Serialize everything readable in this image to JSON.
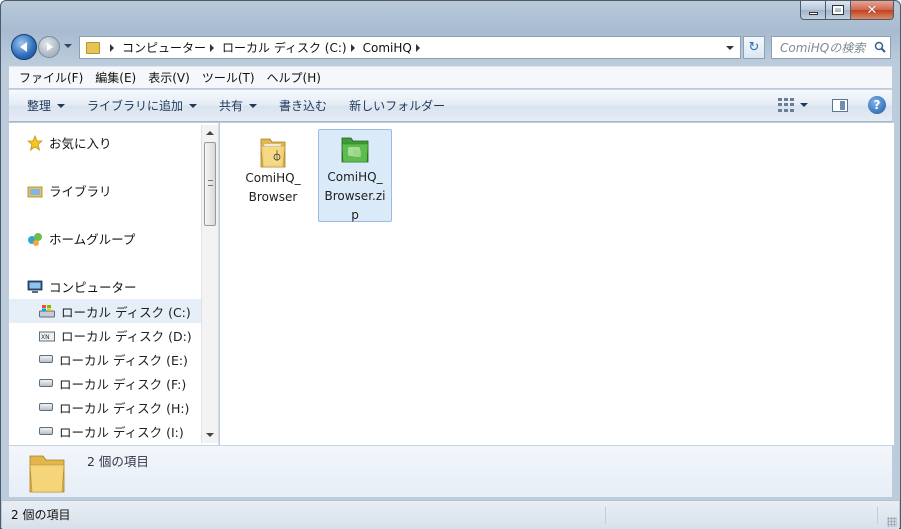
{
  "window": {
    "caption_min": "–",
    "caption_max": "□",
    "caption_close": "✕"
  },
  "navbar": {
    "breadcrumbs": [
      "コンピューター",
      "ローカル ディスク (C:)",
      "ComiHQ"
    ],
    "search_placeholder": "ComiHQの検索",
    "refresh_glyph": "↻"
  },
  "menubar": {
    "items": [
      "ファイル(F)",
      "編集(E)",
      "表示(V)",
      "ツール(T)",
      "ヘルプ(H)"
    ]
  },
  "commandbar": {
    "organize": "整理",
    "add_to_library": "ライブラリに追加",
    "share": "共有",
    "burn": "書き込む",
    "new_folder": "新しいフォルダー",
    "help_glyph": "?"
  },
  "navpane": {
    "favorites": "お気に入り",
    "libraries": "ライブラリ",
    "homegroup": "ホームグループ",
    "computer": "コンピューター",
    "drives": [
      {
        "label": "ローカル ディスク (C:)",
        "icon": "windows-drive-icon",
        "selected": true
      },
      {
        "label": "ローカル ディスク (D:)",
        "icon": "drive-icon",
        "selected": false
      },
      {
        "label": "ローカル ディスク (E:)",
        "icon": "drive-icon",
        "selected": false
      },
      {
        "label": "ローカル ディスク (F:)",
        "icon": "drive-icon",
        "selected": false
      },
      {
        "label": "ローカル ディスク (H:)",
        "icon": "drive-icon",
        "selected": false
      },
      {
        "label": "ローカル ディスク (I:)",
        "icon": "drive-icon",
        "selected": false
      }
    ]
  },
  "content": {
    "files": [
      {
        "name_line1": "ComiHQ_",
        "name_line2": "Browser",
        "name_line3": "",
        "icon": "folder-icon",
        "selected": false
      },
      {
        "name_line1": "ComiHQ_",
        "name_line2": "Browser.zi",
        "name_line3": "p",
        "icon": "zip-folder-icon",
        "selected": true
      }
    ]
  },
  "details": {
    "count": "2 個の項目"
  },
  "statusbar": {
    "text": "2 個の項目"
  },
  "colors": {
    "selection": "#dbeaf9",
    "accent_blue": "#1b5aa6",
    "folder_yellow": "#e8c35a",
    "zip_green": "#4fae45"
  }
}
